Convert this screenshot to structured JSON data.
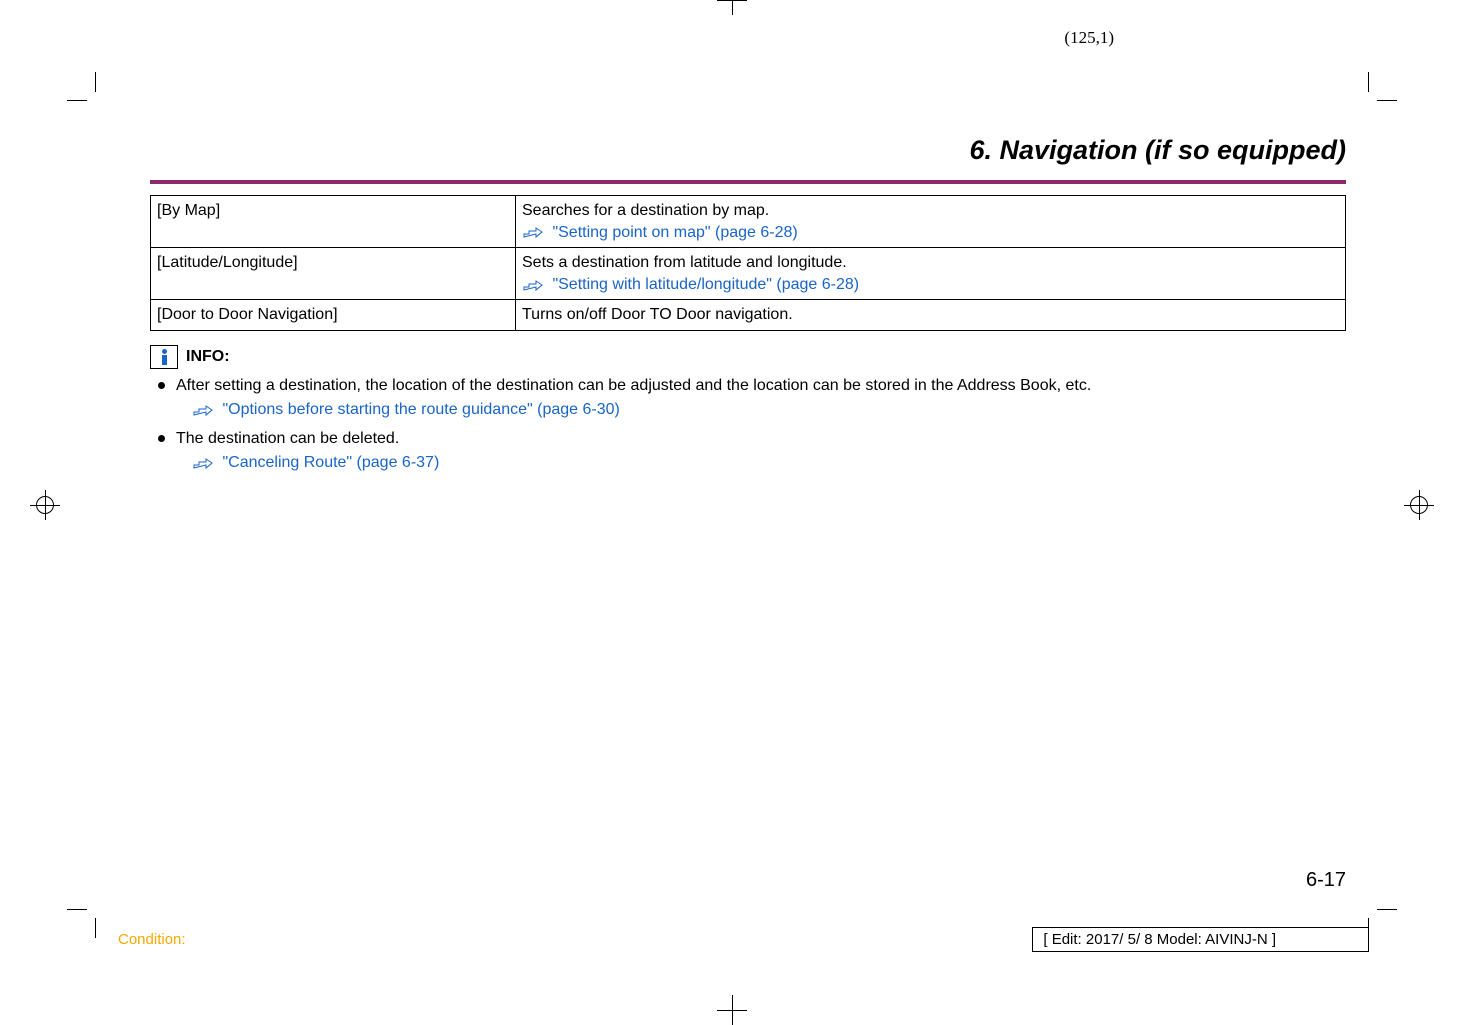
{
  "folio_top": "(125,1)",
  "header": {
    "title": "6. Navigation (if so equipped)"
  },
  "table": {
    "rows": [
      {
        "label": "[By Map]",
        "desc": "Searches for a destination by map.",
        "ref": "\"Setting point on map\" (page 6-28)"
      },
      {
        "label": "[Latitude/Longitude]",
        "desc": "Sets a destination from latitude and longitude.",
        "ref": "\"Setting with latitude/longitude\" (page 6-28)"
      },
      {
        "label": "[Door to Door Navigation]",
        "desc": "Turns on/off Door TO Door navigation.",
        "ref": ""
      }
    ]
  },
  "info": {
    "label": "INFO:",
    "items": [
      {
        "text": "After setting a destination, the location of the destination can be adjusted and the location can be stored in the Address Book, etc.",
        "ref": "\"Options before starting the route guidance\" (page 6-30)"
      },
      {
        "text": "The destination can be deleted.",
        "ref": "\"Canceling Route\" (page 6-37)"
      }
    ]
  },
  "page_num": "6-17",
  "condition": "Condition:",
  "edit_box": "[ Edit: 2017/ 5/ 8    Model:  AIVINJ-N ]"
}
